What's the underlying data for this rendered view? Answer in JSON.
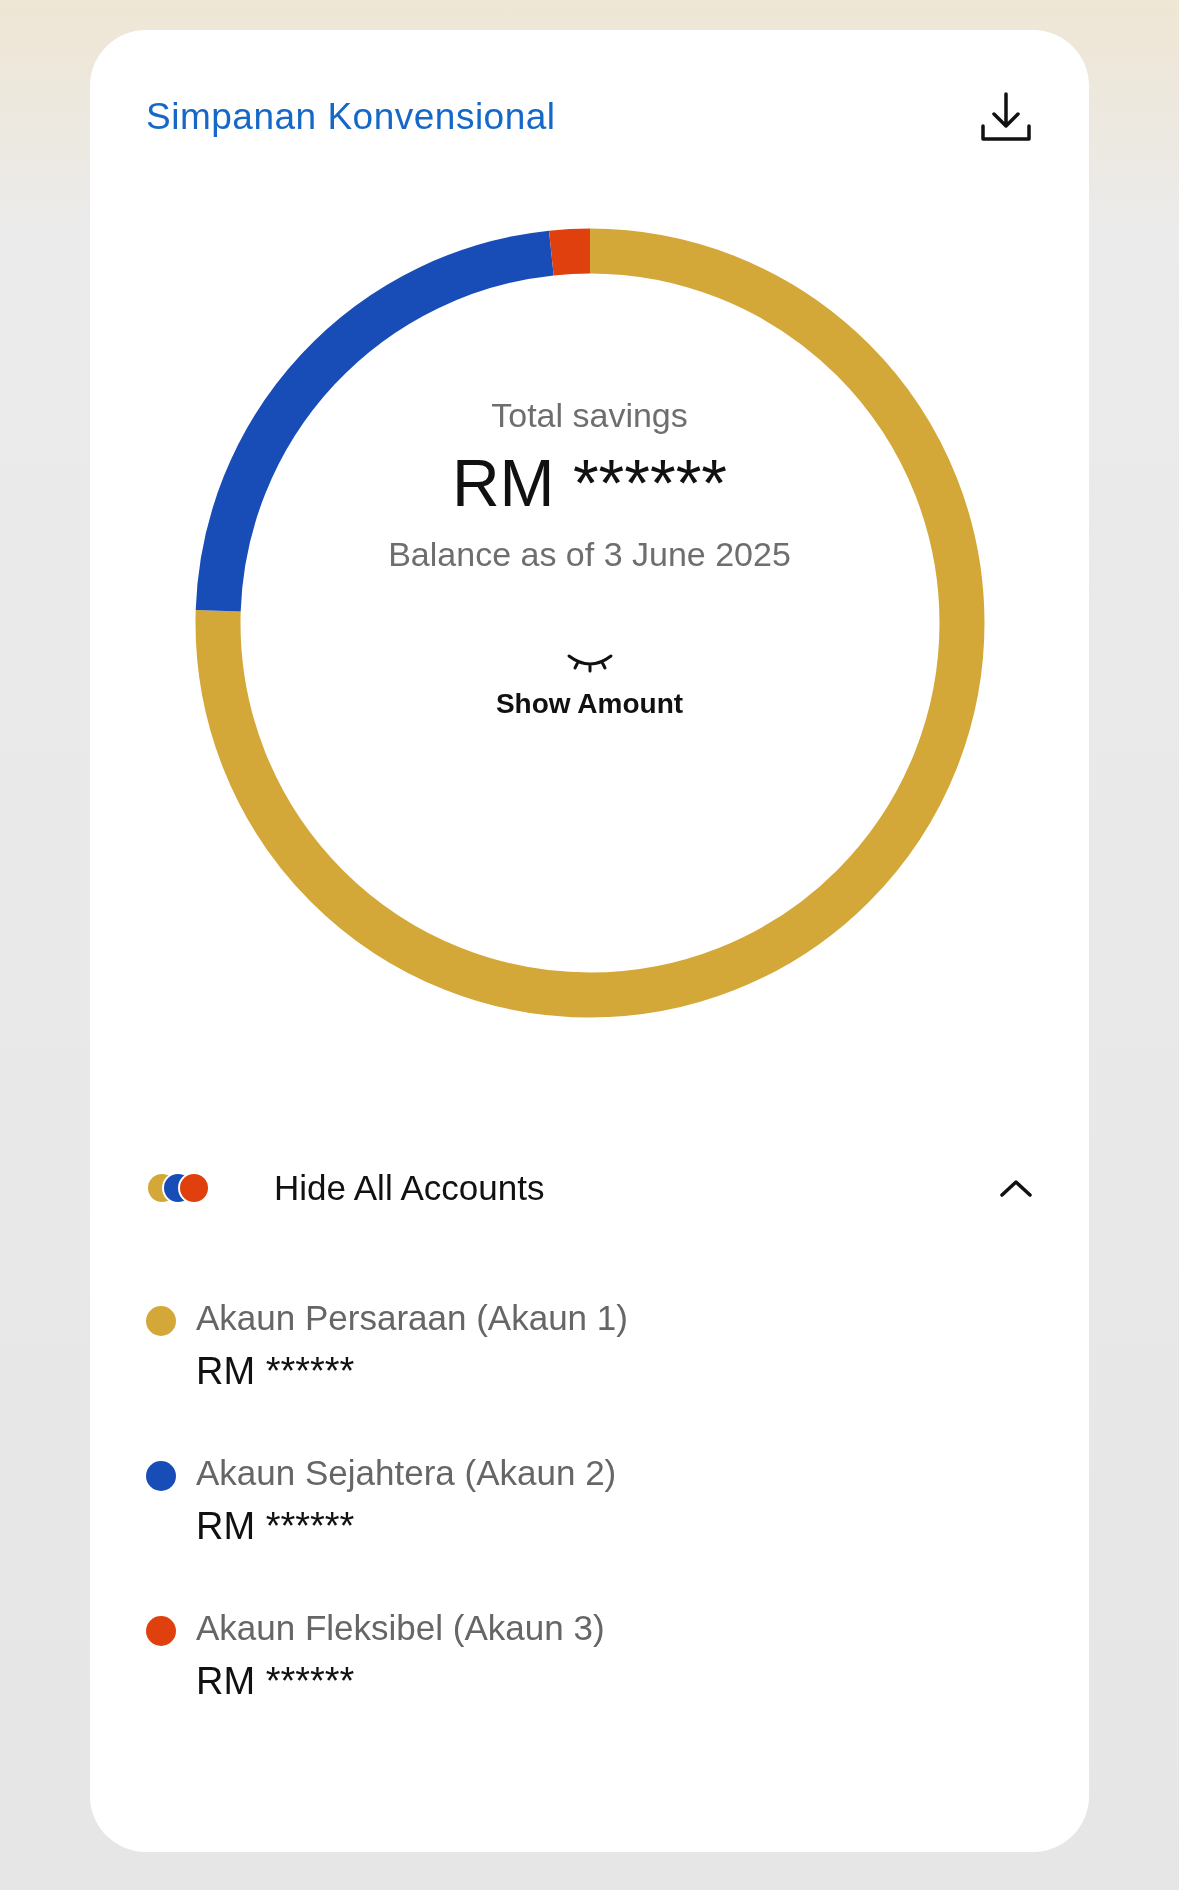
{
  "card": {
    "title": "Simpanan Konvensional"
  },
  "summary": {
    "label": "Total savings",
    "amount": "RM ******",
    "date": "Balance as of 3 June 2025",
    "toggle_label": "Show Amount"
  },
  "accounts_toggle": {
    "label": "Hide All Accounts",
    "expanded": true
  },
  "accounts": [
    {
      "name": "Akaun Persaraan (Akaun 1)",
      "amount": "RM ******",
      "color": "#d4a838"
    },
    {
      "name": "Akaun Sejahtera (Akaun 2)",
      "amount": "RM ******",
      "color": "#184db8"
    },
    {
      "name": "Akaun Fleksibel (Akaun 3)",
      "amount": "RM ******",
      "color": "#e0400e"
    }
  ]
}
